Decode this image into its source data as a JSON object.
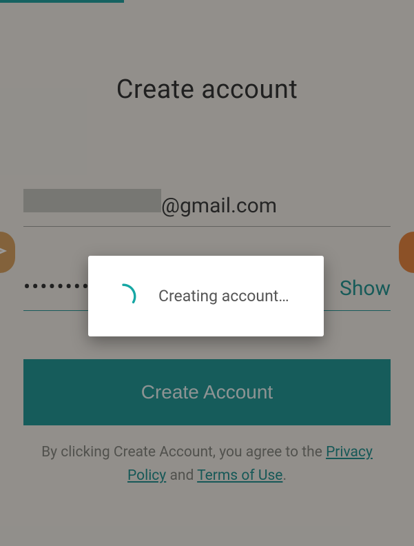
{
  "title": "Create account",
  "email": {
    "domain_part": "@gmail.com"
  },
  "password": {
    "mask": "•••••••••••",
    "show_label": "Show"
  },
  "submit_label": "Create Account",
  "legal": {
    "prefix": "By clicking Create Account, you agree to the ",
    "privacy": "Privacy Policy",
    "and": " and ",
    "terms": "Terms of Use",
    "suffix": "."
  },
  "modal": {
    "message": "Creating account…"
  },
  "colors": {
    "accent": "#0f9a97",
    "button": "#0f8f8c",
    "side_left": "#d69a52",
    "side_right": "#e57a2e"
  }
}
